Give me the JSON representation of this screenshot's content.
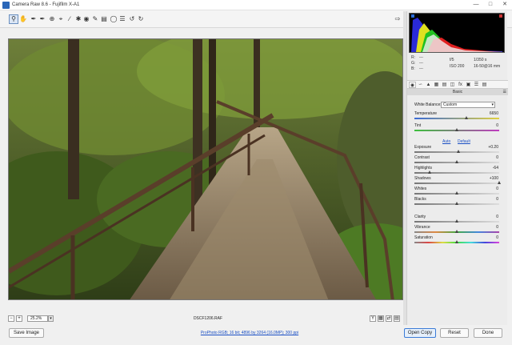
{
  "window": {
    "title": "Camera Raw 8.6  -  Fujifilm X-A1"
  },
  "toolbar": {
    "tools": [
      "zoom-tool-icon",
      "hand-tool-icon",
      "white-balance-tool-icon",
      "color-sampler-icon",
      "targeted-adjustment-icon",
      "crop-tool-icon",
      "straighten-tool-icon",
      "spot-removal-icon",
      "red-eye-icon",
      "adjustment-brush-icon",
      "graduated-filter-icon",
      "radial-filter-icon",
      "open-preferences-icon",
      "rotate-ccw-icon",
      "rotate-cw-icon"
    ],
    "full_screen_icon": "full-screen-icon"
  },
  "preview": {
    "filename": "DSCF1206.RAF",
    "zoom": "25.2%"
  },
  "histogram": {
    "r": "R:",
    "g": "G:",
    "b": "B:",
    "r_val": "---",
    "g_val": "---",
    "b_val": "---",
    "aperture": "f/5",
    "shutter": "1/350 s",
    "iso": "ISO 200",
    "lens": "16-50@16 mm"
  },
  "panel": {
    "section_title": "Basic",
    "white_balance_label": "White Balance:",
    "white_balance_value": "Custom",
    "auto_label": "Auto",
    "default_label": "Default",
    "sliders": [
      {
        "label": "Temperature",
        "value": "6650",
        "pos": 0.62
      },
      {
        "label": "Tint",
        "value": "0",
        "pos": 0.5
      },
      {
        "label": "Exposure",
        "value": "+0.20",
        "pos": 0.52
      },
      {
        "label": "Contrast",
        "value": "0",
        "pos": 0.5
      },
      {
        "label": "Highlights",
        "value": "-64",
        "pos": 0.18
      },
      {
        "label": "Shadows",
        "value": "+100",
        "pos": 1.0
      },
      {
        "label": "Whites",
        "value": "0",
        "pos": 0.5
      },
      {
        "label": "Blacks",
        "value": "0",
        "pos": 0.5
      },
      {
        "label": "Clarity",
        "value": "0",
        "pos": 0.5
      },
      {
        "label": "Vibrance",
        "value": "0",
        "pos": 0.5
      },
      {
        "label": "Saturation",
        "value": "0",
        "pos": 0.5
      }
    ]
  },
  "bottom": {
    "save_image": "Save Image",
    "workflow_link": "ProPhoto RGB; 16 bit; 4896 by 3264 (16.0MP); 300 ppi",
    "open_copy": "Open Copy",
    "reset": "Reset",
    "done": "Done"
  }
}
